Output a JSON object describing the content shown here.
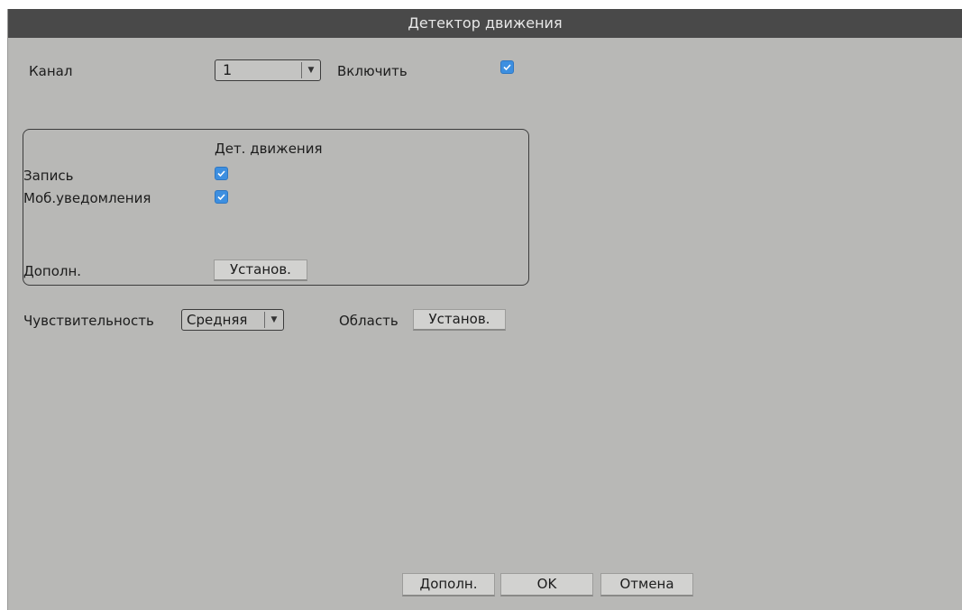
{
  "title": "Детектор движения",
  "channel": {
    "label": "Канал",
    "value": "1"
  },
  "enable": {
    "label": "Включить",
    "checked": true
  },
  "group": {
    "column_header": "Дет. движения",
    "record_label": "Запись",
    "record_checked": true,
    "mobile_label": "Моб.уведомления",
    "mobile_checked": true,
    "extra_label": "Дополн.",
    "extra_button": "Установ."
  },
  "sensitivity": {
    "label": "Чувствительность",
    "value": "Средняя"
  },
  "area": {
    "label": "Область",
    "button": "Установ."
  },
  "footer": {
    "more": "Дополн.",
    "ok": "OK",
    "cancel": "Отмена"
  },
  "colors": {
    "background": "#b8b8b6",
    "titlebar": "#494949",
    "checkbox": "#3d8fe0"
  }
}
